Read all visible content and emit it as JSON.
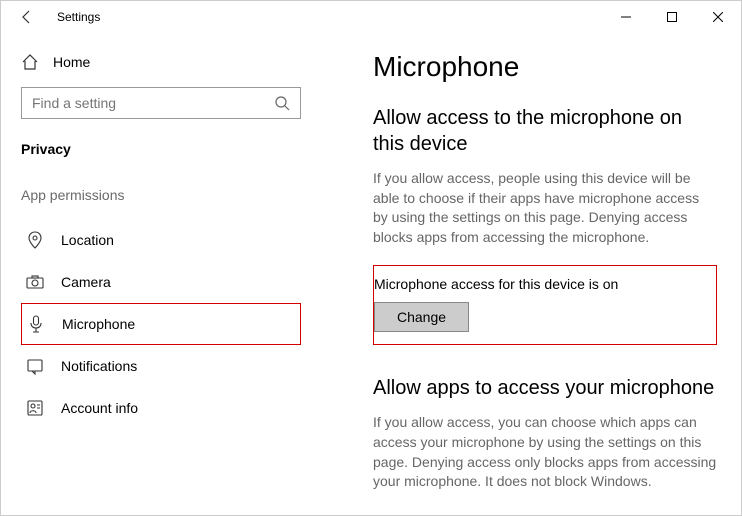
{
  "titlebar": {
    "title": "Settings"
  },
  "sidebar": {
    "home_label": "Home",
    "search_placeholder": "Find a setting",
    "section_label": "Privacy",
    "group_label": "App permissions",
    "items": [
      {
        "label": "Location"
      },
      {
        "label": "Camera"
      },
      {
        "label": "Microphone"
      },
      {
        "label": "Notifications"
      },
      {
        "label": "Account info"
      }
    ]
  },
  "main": {
    "heading": "Microphone",
    "section1": {
      "title": "Allow access to the microphone on this device",
      "desc": "If you allow access, people using this device will be able to choose if their apps have microphone access by using the settings on this page. Denying access blocks apps from accessing the microphone.",
      "status": "Microphone access for this device is on",
      "change_label": "Change"
    },
    "section2": {
      "title": "Allow apps to access your microphone",
      "desc": "If you allow access, you can choose which apps can access your microphone by using the settings on this page. Denying access only blocks apps from accessing your microphone. It does not block Windows."
    }
  }
}
